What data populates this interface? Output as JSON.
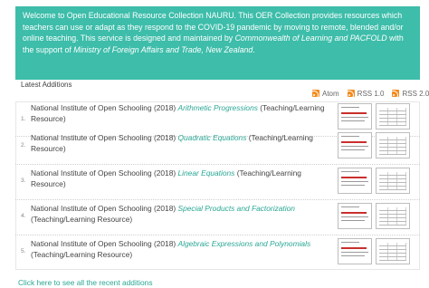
{
  "banner": {
    "text_1": "Welcome to Open Educational Resource Collection NAURU. This OER Collection provides resources which teachers can use or adapt as they respond to the COVID-19 pandemic by moving to remote, blended and/or online teaching. This service is designed and maintained by ",
    "link_1": "Commonwealth of Learning and PACFOLD",
    "text_2": " with the support of ",
    "link_2": "Ministry of Foreign Affairs and Trade, New Zealand",
    "text_3": "."
  },
  "feeds": [
    {
      "label": "Atom",
      "icon": "rss-icon"
    },
    {
      "label": "RSS 1.0",
      "icon": "rss-icon"
    },
    {
      "label": "RSS 2.0",
      "icon": "rss-icon"
    }
  ],
  "latest_additions": {
    "heading": "Latest Additions",
    "items": [
      {
        "num": "1.",
        "author": "National Institute of Open Schooling",
        "year": "(2018)",
        "title": "Arithmetic Progressions",
        "type": "(Teaching/Learning Resource)"
      },
      {
        "num": "2.",
        "author": "National Institute of Open Schooling",
        "year": "(2018)",
        "title": "Quadratic Equations",
        "type": "(Teaching/Learning Resource)"
      },
      {
        "num": "3.",
        "author": "National Institute of Open Schooling",
        "year": "(2018)",
        "title": "Linear Equations",
        "type": "(Teaching/Learning Resource)"
      },
      {
        "num": "4.",
        "author": "National Institute of Open Schooling",
        "year": "(2018)",
        "title": "Special Products and Factorization",
        "type": "(Teaching/Learning Resource)"
      },
      {
        "num": "5.",
        "author": "National Institute of Open Schooling",
        "year": "(2018)",
        "title": "Algebraic Expressions and Polynomials",
        "type": "(Teaching/Learning Resource)"
      }
    ]
  },
  "more_link": "Click here to see all the recent additions",
  "colors": {
    "banner_bg": "#3dbdaa",
    "link": "#2aa795",
    "rss": "#f38b1f"
  }
}
